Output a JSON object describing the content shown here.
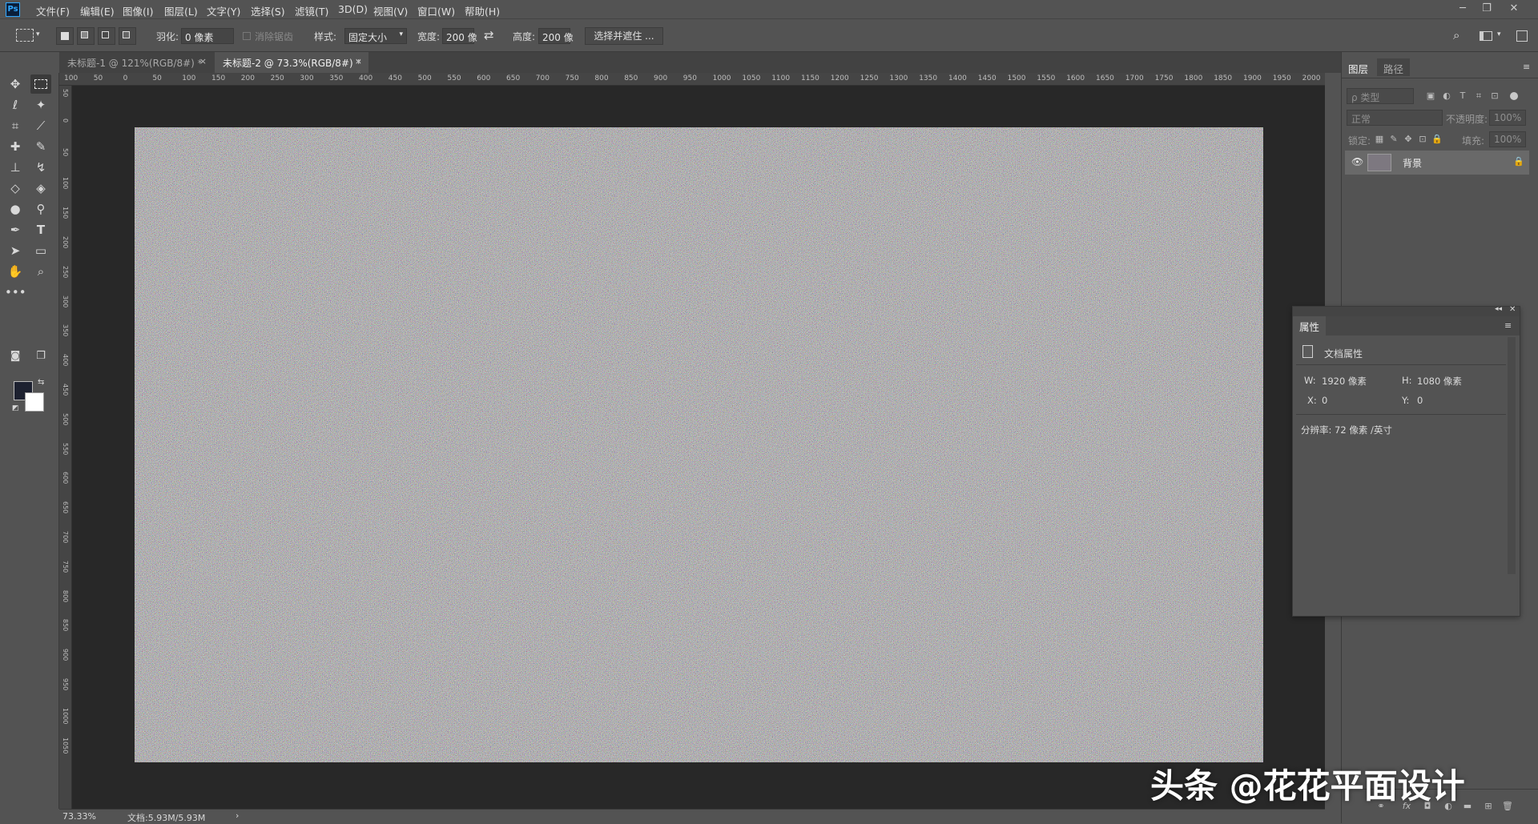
{
  "app": {
    "logo": "Ps"
  },
  "menu": [
    "文件(F)",
    "编辑(E)",
    "图像(I)",
    "图层(L)",
    "文字(Y)",
    "选择(S)",
    "滤镜(T)",
    "3D(D)",
    "视图(V)",
    "窗口(W)",
    "帮助(H)"
  ],
  "window_buttons": {
    "minimize": "─",
    "restore": "❐",
    "close": "✕"
  },
  "options": {
    "feather_label": "羽化:",
    "feather_value": "0 像素",
    "antialias_label": "消除锯齿",
    "style_label": "样式:",
    "style_value": "固定大小",
    "width_label": "宽度:",
    "width_value": "200 像",
    "swap_icon": "⇄",
    "height_label": "高度:",
    "height_value": "200 像",
    "select_mask_button": "选择并遮住 ..."
  },
  "tabs": [
    {
      "label": "未标题-1 @ 121%(RGB/8#) *",
      "close": "×"
    },
    {
      "label": "未标题-2 @ 73.3%(RGB/8#) *",
      "close": "×"
    }
  ],
  "ruler_h": [
    "100",
    "50",
    "0",
    "50",
    "100",
    "150",
    "200",
    "250",
    "300",
    "350",
    "400",
    "450",
    "500",
    "550",
    "600",
    "650",
    "700",
    "750",
    "800",
    "850",
    "900",
    "950",
    "1000",
    "1050",
    "1100",
    "1150",
    "1200",
    "1250",
    "1300",
    "1350",
    "1400",
    "1450",
    "1500",
    "1550",
    "1600",
    "1650",
    "1700",
    "1750",
    "1800",
    "1850",
    "1900",
    "1950",
    "2000"
  ],
  "ruler_v": [
    "50",
    "0",
    "50",
    "100",
    "150",
    "200",
    "250",
    "300",
    "350",
    "400",
    "450",
    "500",
    "550",
    "600",
    "650",
    "700",
    "750",
    "800",
    "850",
    "900",
    "950",
    "1000",
    "1050"
  ],
  "status": {
    "zoom": "73.33%",
    "doc_size": "文档:5.93M/5.93M",
    "arrow": "›"
  },
  "layers_panel": {
    "tabs": [
      "图层",
      "路径"
    ],
    "filter_placeholder": "ρ 类型",
    "blend_mode": "正常",
    "opacity_label": "不透明度:",
    "opacity_value": "100%",
    "lock_label": "锁定:",
    "fill_label": "填充:",
    "fill_value": "100%",
    "layer_name": "背景"
  },
  "properties_panel": {
    "tab": "属性",
    "section_title": "文档属性",
    "w_label": "W:",
    "w_value": "1920 像素",
    "h_label": "H:",
    "h_value": "1080 像素",
    "x_label": "X:",
    "x_value": "0",
    "y_label": "Y:",
    "y_value": "0",
    "resolution": "分辨率: 72 像素 /英寸"
  },
  "watermark": "头条 @花花平面设计",
  "colors": {
    "foreground": "#1d2130",
    "background": "#ffffff",
    "accent": "#31a8ff"
  }
}
